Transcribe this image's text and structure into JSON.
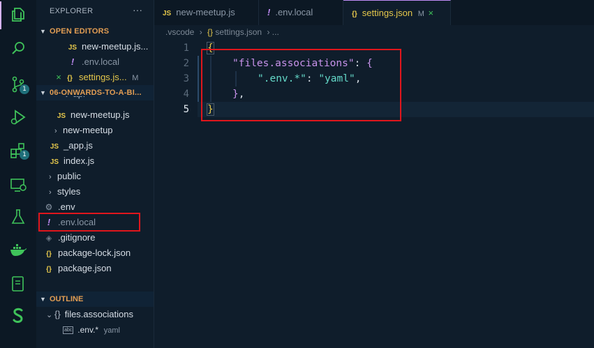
{
  "activity_bar": {
    "source_control_badge": "1",
    "extensions_badge": "1"
  },
  "sidebar": {
    "title": "EXPLORER",
    "more": "···",
    "open_editors": {
      "header": "OPEN EDITORS",
      "items": [
        {
          "icon": "JS",
          "name": "new-meetup.js..."
        },
        {
          "icon": "!",
          "name": ".env.local"
        },
        {
          "close": "×",
          "icon": "{}",
          "name": "settings.js...",
          "status": "M"
        }
      ]
    },
    "project": {
      "header": "06-ONWARDS-TO-A-BI...",
      "items": [
        {
          "name": "api"
        },
        {
          "icon": "JS",
          "name": "new-meetup.js"
        },
        {
          "chevron": "›",
          "name": "new-meetup"
        },
        {
          "icon": "JS",
          "name": "_app.js"
        },
        {
          "icon": "JS",
          "name": "index.js"
        },
        {
          "chevron": "›",
          "name": "public"
        },
        {
          "chevron": "›",
          "name": "styles"
        },
        {
          "icon": "⚙",
          "name": ".env"
        },
        {
          "icon": "!",
          "name": ".env.local"
        },
        {
          "icon": "◈",
          "name": ".gitignore"
        },
        {
          "icon": "{}",
          "name": "package-lock.json"
        },
        {
          "icon": "{}",
          "name": "package.json"
        }
      ]
    },
    "outline": {
      "header": "OUTLINE",
      "items": [
        {
          "chevron": "⌄",
          "icon": "{}",
          "name": "files.associations"
        },
        {
          "icon": "abc",
          "name": ".env.*",
          "detail": "yaml"
        }
      ]
    }
  },
  "tabs": [
    {
      "icon": "JS",
      "label": "new-meetup.js"
    },
    {
      "icon": "!",
      "label": ".env.local"
    },
    {
      "icon": "{}",
      "label": "settings.json",
      "status": "M",
      "close": "×"
    }
  ],
  "breadcrumbs": {
    "folder": ".vscode",
    "sep": "›",
    "file_icon": "{}",
    "file": "settings.json",
    "tail": "›  ..."
  },
  "editor": {
    "line_numbers": [
      "1",
      "2",
      "3",
      "4",
      "5"
    ],
    "line1": "{",
    "line2_key": "\"files.associations\"",
    "line2_colon": ": ",
    "line2_brace": "{",
    "line3_key": "\".env.*\"",
    "line3_colon": ": ",
    "line3_value": "\"yaml\"",
    "line3_comma": ",",
    "line4_brace": "}",
    "line4_comma": ",",
    "line5": "}"
  }
}
